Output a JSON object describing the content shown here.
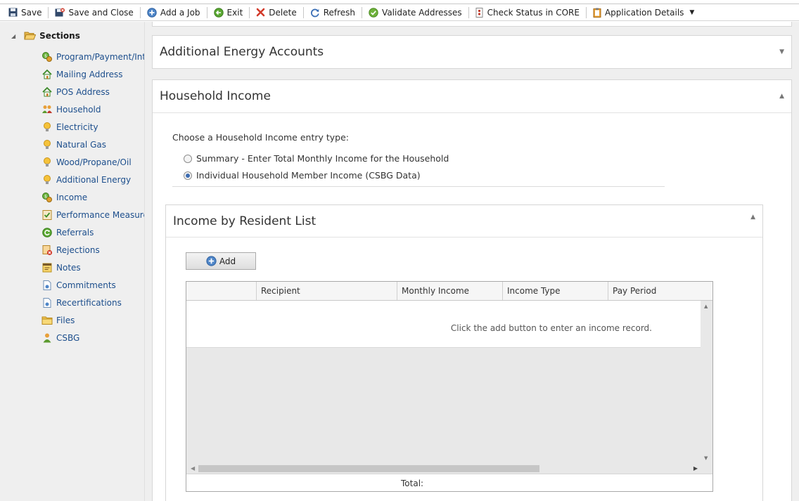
{
  "toolbar": {
    "save": "Save",
    "save_close": "Save and Close",
    "add_job": "Add a Job",
    "exit": "Exit",
    "delete": "Delete",
    "refresh": "Refresh",
    "validate": "Validate Addresses",
    "check_status": "Check Status in CORE",
    "app_details": "Application Details"
  },
  "sidebar": {
    "root": "Sections",
    "items": [
      {
        "label": "Program/Payment/Int",
        "icon": "money-gear-icon"
      },
      {
        "label": "Mailing Address",
        "icon": "house-icon"
      },
      {
        "label": "POS Address",
        "icon": "house-icon"
      },
      {
        "label": "Household",
        "icon": "people-icon"
      },
      {
        "label": "Electricity",
        "icon": "lightbulb-icon"
      },
      {
        "label": "Natural Gas",
        "icon": "lightbulb-icon"
      },
      {
        "label": "Wood/Propane/Oil",
        "icon": "lightbulb-icon"
      },
      {
        "label": "Additional Energy",
        "icon": "lightbulb-icon"
      },
      {
        "label": "Income",
        "icon": "money-gear-icon"
      },
      {
        "label": "Performance Measure",
        "icon": "checklist-icon"
      },
      {
        "label": "Referrals",
        "icon": "refresh-green-icon"
      },
      {
        "label": "Rejections",
        "icon": "reject-icon"
      },
      {
        "label": "Notes",
        "icon": "note-icon"
      },
      {
        "label": "Commitments",
        "icon": "document-icon"
      },
      {
        "label": "Recertifications",
        "icon": "document-icon"
      },
      {
        "label": "Files",
        "icon": "folder-icon"
      },
      {
        "label": "CSBG",
        "icon": "person-icon"
      }
    ]
  },
  "panels": {
    "additional_energy": "Additional Energy Accounts",
    "household_income": "Household Income"
  },
  "income_form": {
    "choose_label": "Choose a Household Income entry type:",
    "option_summary": "Summary - Enter Total Monthly Income for the Household",
    "option_individual": "Individual Household Member Income (CSBG Data)",
    "selected": "individual"
  },
  "resident_list": {
    "title": "Income by Resident List",
    "add_label": "Add",
    "columns": [
      "",
      "Recipient",
      "Monthly Income",
      "Income Type",
      "Pay Period"
    ],
    "empty_message": "Click the add button to enter an income record.",
    "total_label": "Total:"
  },
  "colors": {
    "link": "#1c4e8c",
    "sidebar_bg": "#efefef",
    "radio_accent": "#3d6cb1"
  }
}
